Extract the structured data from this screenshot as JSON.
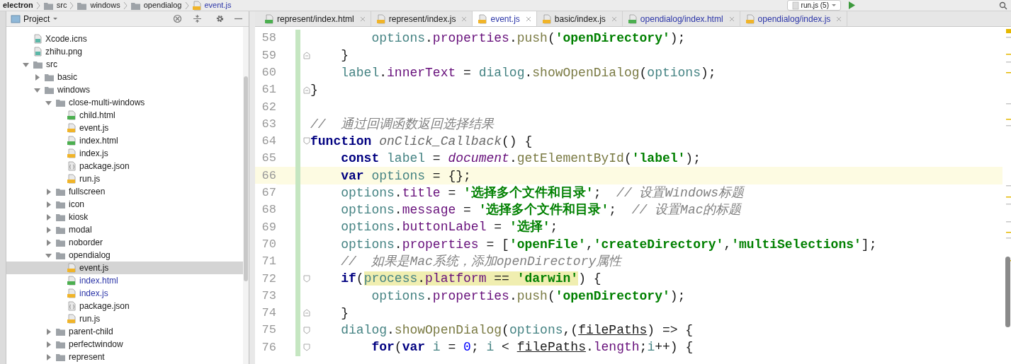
{
  "breadcrumb": [
    {
      "label": "electron",
      "kind": "project"
    },
    {
      "label": "src",
      "kind": "folder"
    },
    {
      "label": "windows",
      "kind": "folder"
    },
    {
      "label": "opendialog",
      "kind": "folder"
    },
    {
      "label": "event.js",
      "kind": "js"
    }
  ],
  "run_config": {
    "label": "run.js (5)"
  },
  "project_panel": {
    "title": "Project"
  },
  "tree": [
    {
      "name": "Xcode.icns",
      "kind": "image",
      "selected": false,
      "modified": false
    },
    {
      "name": "zhihu.png",
      "kind": "image",
      "selected": false,
      "modified": false
    },
    {
      "name": "src",
      "kind": "folder",
      "expanded": true,
      "selected": false,
      "children": [
        {
          "name": "basic",
          "kind": "folder",
          "expanded": false,
          "selected": false
        },
        {
          "name": "windows",
          "kind": "folder",
          "expanded": true,
          "selected": false,
          "children": [
            {
              "name": "close-multi-windows",
              "kind": "folder",
              "expanded": true,
              "selected": false,
              "children": [
                {
                  "name": "child.html",
                  "kind": "html",
                  "selected": false,
                  "modified": false
                },
                {
                  "name": "event.js",
                  "kind": "js",
                  "selected": false,
                  "modified": false
                },
                {
                  "name": "index.html",
                  "kind": "html",
                  "selected": false,
                  "modified": false
                },
                {
                  "name": "index.js",
                  "kind": "js",
                  "selected": false,
                  "modified": false
                },
                {
                  "name": "package.json",
                  "kind": "json",
                  "selected": false,
                  "modified": false
                },
                {
                  "name": "run.js",
                  "kind": "js",
                  "selected": false,
                  "modified": false
                }
              ]
            },
            {
              "name": "fullscreen",
              "kind": "folder",
              "expanded": false,
              "selected": false
            },
            {
              "name": "icon",
              "kind": "folder",
              "expanded": false,
              "selected": false
            },
            {
              "name": "kiosk",
              "kind": "folder",
              "expanded": false,
              "selected": false
            },
            {
              "name": "modal",
              "kind": "folder",
              "expanded": false,
              "selected": false
            },
            {
              "name": "noborder",
              "kind": "folder",
              "expanded": false,
              "selected": false
            },
            {
              "name": "opendialog",
              "kind": "folder",
              "expanded": true,
              "selected": false,
              "children": [
                {
                  "name": "event.js",
                  "kind": "js",
                  "selected": true,
                  "modified": false
                },
                {
                  "name": "index.html",
                  "kind": "html",
                  "selected": false,
                  "modified": true
                },
                {
                  "name": "index.js",
                  "kind": "js",
                  "selected": false,
                  "modified": true
                },
                {
                  "name": "package.json",
                  "kind": "json",
                  "selected": false,
                  "modified": false
                },
                {
                  "name": "run.js",
                  "kind": "js",
                  "selected": false,
                  "modified": false
                }
              ]
            },
            {
              "name": "parent-child",
              "kind": "folder",
              "expanded": false,
              "selected": false
            },
            {
              "name": "perfectwindow",
              "kind": "folder",
              "expanded": false,
              "selected": false
            },
            {
              "name": "represent",
              "kind": "folder",
              "expanded": false,
              "selected": false
            }
          ]
        }
      ]
    }
  ],
  "tabs": [
    {
      "label": "represent/index.html",
      "kind": "html",
      "selected": false,
      "color": "#1a1a1a"
    },
    {
      "label": "represent/index.js",
      "kind": "js",
      "selected": false,
      "color": "#1a1a1a"
    },
    {
      "label": "event.js",
      "kind": "js",
      "selected": true,
      "color": "#2c36a8"
    },
    {
      "label": "basic/index.js",
      "kind": "js",
      "selected": false,
      "color": "#1a1a1a"
    },
    {
      "label": "opendialog/index.html",
      "kind": "html",
      "selected": false,
      "color": "#2c36a8"
    },
    {
      "label": "opendialog/index.js",
      "kind": "js",
      "selected": false,
      "color": "#2c36a8"
    }
  ],
  "code_lines": [
    {
      "number": "58",
      "current": false,
      "kind": "plain",
      "tokens": [
        {
          "kind": "var",
          "text": "        options"
        },
        {
          "kind": "plain",
          "text": "."
        },
        {
          "kind": "field",
          "text": "properties"
        },
        {
          "kind": "plain",
          "text": "."
        },
        {
          "kind": "call",
          "text": "push"
        },
        {
          "kind": "plain",
          "text": "("
        },
        {
          "kind": "str",
          "text": "'openDirectory'"
        },
        {
          "kind": "plain",
          "text": ");"
        }
      ]
    },
    {
      "number": "59",
      "current": false,
      "kind": "fold-end",
      "tokens": [
        {
          "kind": "plain",
          "text": "    }"
        }
      ]
    },
    {
      "number": "60",
      "current": false,
      "kind": "plain",
      "tokens": [
        {
          "kind": "var",
          "text": "    label"
        },
        {
          "kind": "plain",
          "text": "."
        },
        {
          "kind": "field",
          "text": "innerText"
        },
        {
          "kind": "plain",
          "text": " = "
        },
        {
          "kind": "var",
          "text": "dialog"
        },
        {
          "kind": "plain",
          "text": "."
        },
        {
          "kind": "call",
          "text": "showOpenDialog"
        },
        {
          "kind": "plain",
          "text": "("
        },
        {
          "kind": "var",
          "text": "options"
        },
        {
          "kind": "plain",
          "text": ");"
        }
      ]
    },
    {
      "number": "61",
      "current": false,
      "kind": "fold-end",
      "tokens": [
        {
          "kind": "plain",
          "text": "}"
        }
      ]
    },
    {
      "number": "62",
      "current": false,
      "kind": "plain"
    },
    {
      "number": "63",
      "current": false,
      "kind": "plain",
      "tokens": [
        {
          "kind": "comment",
          "text": "//  通过回调函数返回选择结果"
        }
      ]
    },
    {
      "number": "64",
      "current": false,
      "kind": "fold-start",
      "tokens": [
        {
          "kind": "keyword",
          "text": "function "
        },
        {
          "kind": "decl",
          "text": "onClick_Callback"
        },
        {
          "kind": "plain",
          "text": "() {"
        }
      ]
    },
    {
      "number": "65",
      "current": false,
      "kind": "plain",
      "tokens": [
        {
          "kind": "keyword",
          "text": "    const "
        },
        {
          "kind": "var",
          "text": "label"
        },
        {
          "kind": "plain",
          "text": " = "
        },
        {
          "kind": "global",
          "text": "document"
        },
        {
          "kind": "plain",
          "text": "."
        },
        {
          "kind": "call",
          "text": "getElementById"
        },
        {
          "kind": "plain",
          "text": "("
        },
        {
          "kind": "str",
          "text": "'label'"
        },
        {
          "kind": "plain",
          "text": ");"
        }
      ]
    },
    {
      "number": "66",
      "current": true,
      "kind": "plain",
      "tokens": [
        {
          "kind": "keyword",
          "text": "    var "
        },
        {
          "kind": "var",
          "text": "options"
        },
        {
          "kind": "plain",
          "text": " = {};"
        }
      ]
    },
    {
      "number": "67",
      "current": false,
      "kind": "plain",
      "tokens": [
        {
          "kind": "var",
          "text": "    options"
        },
        {
          "kind": "plain",
          "text": "."
        },
        {
          "kind": "field",
          "text": "title"
        },
        {
          "kind": "plain",
          "text": " = "
        },
        {
          "kind": "str",
          "text": "'选择多个文件和目录'"
        },
        {
          "kind": "plain",
          "text": ";  "
        },
        {
          "kind": "comment",
          "text": "// 设置Windows标题"
        }
      ]
    },
    {
      "number": "68",
      "current": false,
      "kind": "plain",
      "tokens": [
        {
          "kind": "var",
          "text": "    options"
        },
        {
          "kind": "plain",
          "text": "."
        },
        {
          "kind": "field",
          "text": "message"
        },
        {
          "kind": "plain",
          "text": " = "
        },
        {
          "kind": "str",
          "text": "'选择多个文件和目录'"
        },
        {
          "kind": "plain",
          "text": ";  "
        },
        {
          "kind": "comment",
          "text": "// 设置Mac的标题"
        }
      ]
    },
    {
      "number": "69",
      "current": false,
      "kind": "plain",
      "tokens": [
        {
          "kind": "var",
          "text": "    options"
        },
        {
          "kind": "plain",
          "text": "."
        },
        {
          "kind": "field",
          "text": "buttonLabel"
        },
        {
          "kind": "plain",
          "text": " = "
        },
        {
          "kind": "str",
          "text": "'选择'"
        },
        {
          "kind": "plain",
          "text": ";"
        }
      ]
    },
    {
      "number": "70",
      "current": false,
      "kind": "plain",
      "tokens": [
        {
          "kind": "var",
          "text": "    options"
        },
        {
          "kind": "plain",
          "text": "."
        },
        {
          "kind": "field",
          "text": "properties"
        },
        {
          "kind": "plain",
          "text": " = ["
        },
        {
          "kind": "str",
          "text": "'openFile'"
        },
        {
          "kind": "plain",
          "text": ","
        },
        {
          "kind": "str",
          "text": "'createDirectory'"
        },
        {
          "kind": "plain",
          "text": ","
        },
        {
          "kind": "str",
          "text": "'multiSelections'"
        },
        {
          "kind": "plain",
          "text": "];"
        }
      ]
    },
    {
      "number": "71",
      "current": false,
      "kind": "plain",
      "tokens": [
        {
          "kind": "comment",
          "text": "    //  如果是Mac系统，添加openDirectory属性"
        }
      ]
    },
    {
      "number": "72",
      "current": false,
      "kind": "fold-start",
      "tokens": [
        {
          "kind": "keyword",
          "text": "    if",
          "highlighted": false
        },
        {
          "kind": "plain",
          "text": "(",
          "highlighted": false
        },
        {
          "kind": "var",
          "text": "process",
          "highlighted": true
        },
        {
          "kind": "plain",
          "text": ".",
          "highlighted": true
        },
        {
          "kind": "field",
          "text": "platform",
          "highlighted": true
        },
        {
          "kind": "plain",
          "text": " == ",
          "highlighted": true
        },
        {
          "kind": "str",
          "text": "'darwin'",
          "highlighted": true
        },
        {
          "kind": "plain",
          "text": ") {",
          "highlighted": false
        }
      ]
    },
    {
      "number": "73",
      "current": false,
      "kind": "plain",
      "tokens": [
        {
          "kind": "var",
          "text": "        options"
        },
        {
          "kind": "plain",
          "text": "."
        },
        {
          "kind": "field",
          "text": "properties"
        },
        {
          "kind": "plain",
          "text": "."
        },
        {
          "kind": "call",
          "text": "push"
        },
        {
          "kind": "plain",
          "text": "("
        },
        {
          "kind": "str",
          "text": "'openDirectory'"
        },
        {
          "kind": "plain",
          "text": ");"
        }
      ]
    },
    {
      "number": "74",
      "current": false,
      "kind": "fold-end",
      "tokens": [
        {
          "kind": "plain",
          "text": "    }"
        }
      ]
    },
    {
      "number": "75",
      "current": false,
      "kind": "fold-start",
      "tokens": [
        {
          "kind": "var",
          "text": "    dialog"
        },
        {
          "kind": "plain",
          "text": "."
        },
        {
          "kind": "call",
          "text": "showOpenDialog"
        },
        {
          "kind": "plain",
          "text": "("
        },
        {
          "kind": "var",
          "text": "options"
        },
        {
          "kind": "plain",
          "text": ",("
        },
        {
          "kind": "param",
          "text": "filePaths"
        },
        {
          "kind": "plain",
          "text": ") => {"
        }
      ]
    },
    {
      "number": "76",
      "current": false,
      "kind": "fold-start",
      "tokens": [
        {
          "kind": "keyword",
          "text": "        for"
        },
        {
          "kind": "plain",
          "text": "("
        },
        {
          "kind": "keyword",
          "text": "var "
        },
        {
          "kind": "var",
          "text": "i"
        },
        {
          "kind": "plain",
          "text": " = "
        },
        {
          "kind": "num",
          "text": "0"
        },
        {
          "kind": "plain",
          "text": "; "
        },
        {
          "kind": "var",
          "text": "i"
        },
        {
          "kind": "plain",
          "text": " < "
        },
        {
          "kind": "param",
          "text": "filePaths"
        },
        {
          "kind": "plain",
          "text": "."
        },
        {
          "kind": "field",
          "text": "length"
        },
        {
          "kind": "plain",
          "text": ";"
        },
        {
          "kind": "var",
          "text": "i"
        },
        {
          "kind": "plain",
          "text": "++) {"
        }
      ]
    }
  ]
}
